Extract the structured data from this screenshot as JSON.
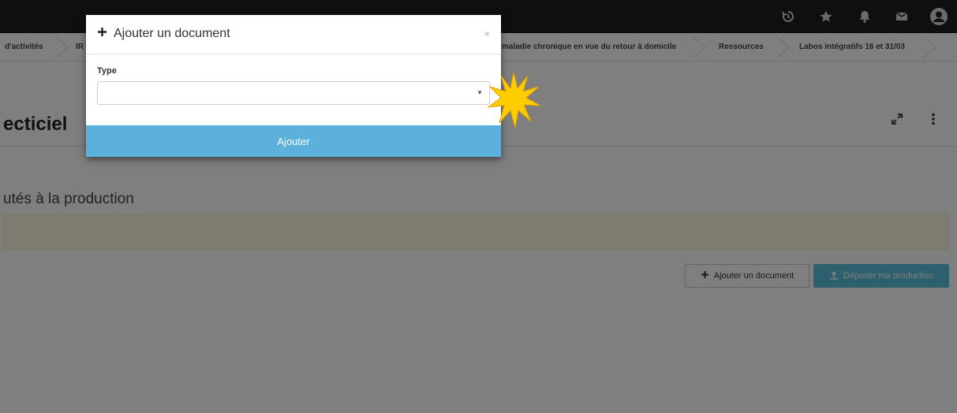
{
  "topbar": {
    "icons": [
      "history-icon",
      "star-icon",
      "bell-icon",
      "mail-icon",
      "user-icon"
    ]
  },
  "breadcrumb": {
    "items": [
      "d'activités",
      "IR",
      "maladie chronique en vue du retour à domicile",
      "Ressources",
      "Labos intégratifs 16 et 31/03"
    ]
  },
  "page": {
    "title": "ecticiel",
    "section_title": "utés à la production",
    "add_document_label": "Ajouter un document",
    "depose_label": "Déposer ma production"
  },
  "modal": {
    "title": "Ajouter un document",
    "close": "×",
    "type_label": "Type",
    "type_value": "",
    "submit_label": "Ajouter"
  },
  "colors": {
    "accent": "#5bb0dc",
    "topbar": "#1e1e1e",
    "highlight": "#ffcc00"
  }
}
